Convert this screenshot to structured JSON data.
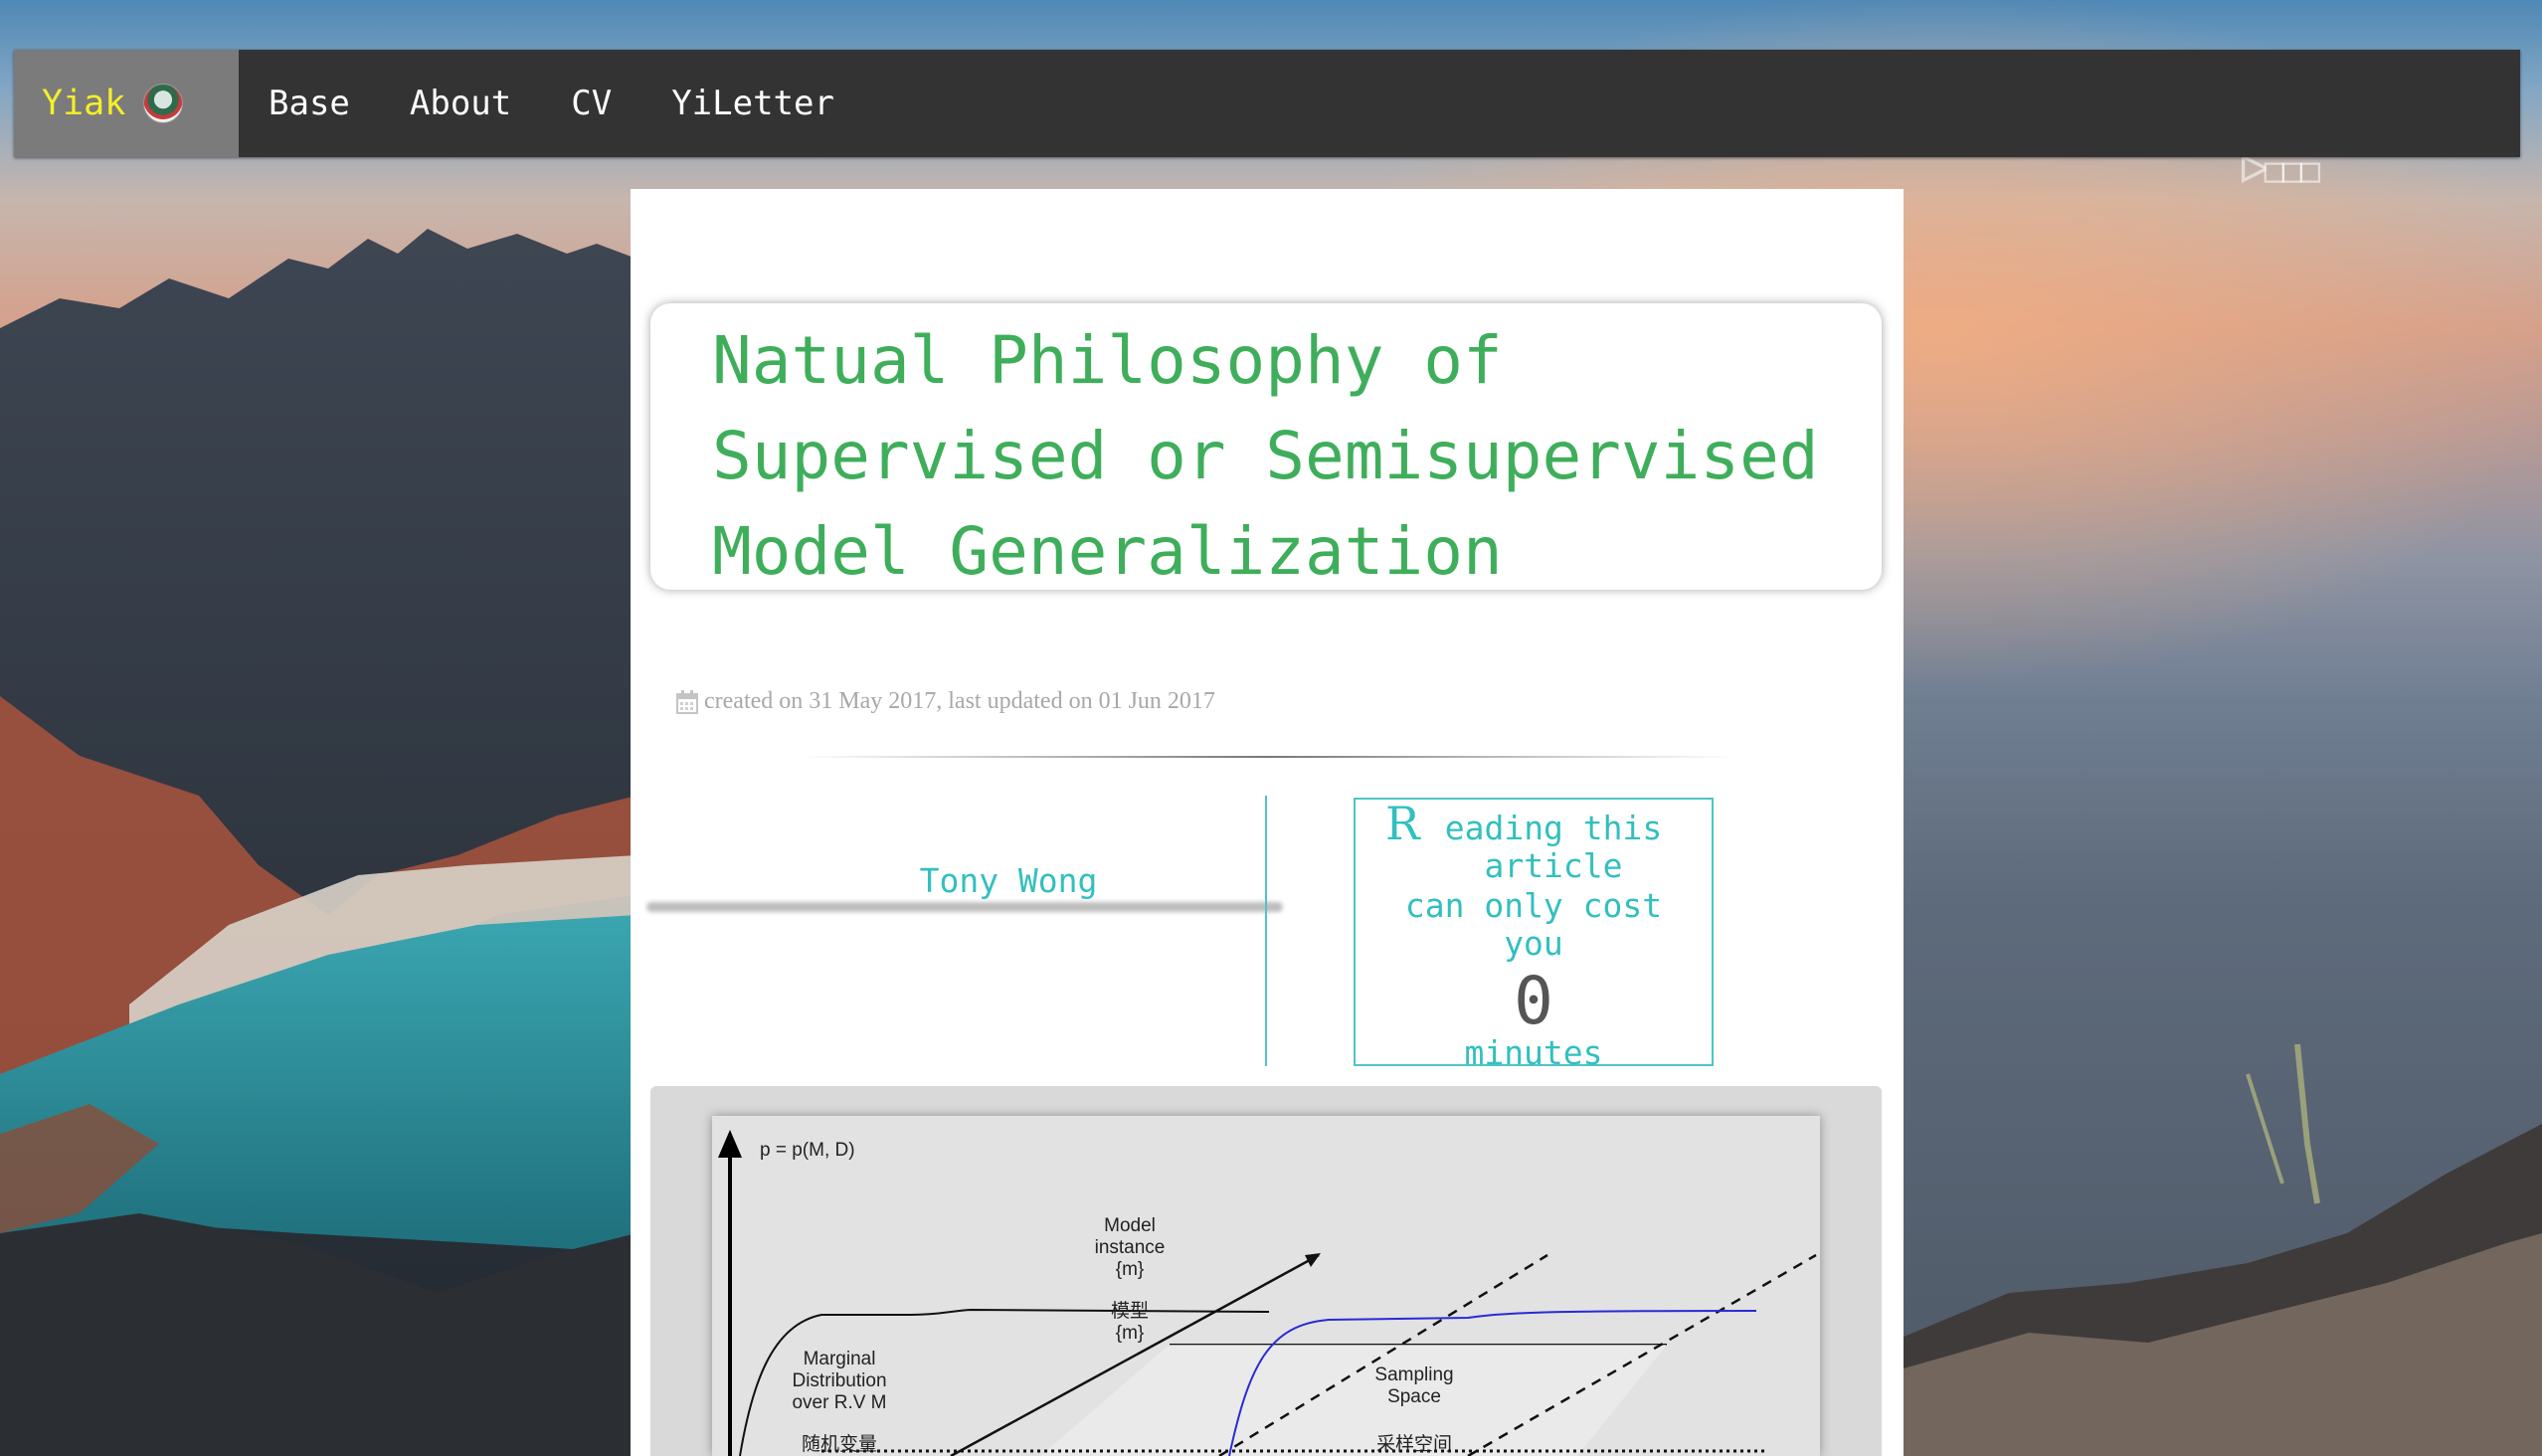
{
  "nav": {
    "brand": "Yiak",
    "links": [
      "Base",
      "About",
      "CV",
      "YiLetter"
    ],
    "corner_glyphs": "ᐅ◻◻◻"
  },
  "article": {
    "title": "Natual Philosophy of Supervised or Semisupervised Model Generalization",
    "meta": "created on 31 May 2017, last updated on 01 Jun 2017",
    "author": "Tony Wong",
    "reading": {
      "initial": "R",
      "line1": "eading this",
      "line2": "article",
      "line3": "can only cost",
      "line4": "you",
      "count": "0",
      "unit": "minutes"
    }
  },
  "figure": {
    "y_axis_label": "p = p(M, D)",
    "model_instance": [
      "Model",
      "instance",
      "{m}"
    ],
    "model_cn": [
      "模型",
      "{m}"
    ],
    "marginal": [
      "Marginal",
      "Distribution",
      "over R.V M"
    ],
    "random_var_cn": "随机变量",
    "sampling": [
      "Sampling",
      "Space"
    ],
    "sampling_cn": "采样空间"
  },
  "colors": {
    "title_green": "#3fae5b",
    "teal": "#33bfbf",
    "brand_yellow": "#f5ef2a",
    "navbar": "#333333"
  }
}
